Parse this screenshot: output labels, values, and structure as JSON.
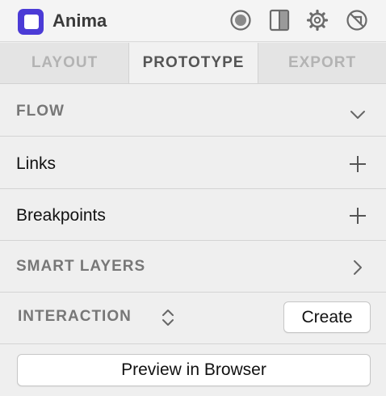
{
  "header": {
    "app_title": "Anima",
    "brand_color": "#4b3bd6",
    "icons": [
      "record-icon",
      "panel-toggle-icon",
      "gear-icon",
      "disable-icon"
    ]
  },
  "tabs": [
    {
      "label": "LAYOUT",
      "active": false
    },
    {
      "label": "PROTOTYPE",
      "active": true
    },
    {
      "label": "EXPORT",
      "active": false
    }
  ],
  "sections": {
    "flow": {
      "label": "FLOW",
      "icon": "chevron-down-icon"
    },
    "links": {
      "label": "Links",
      "icon": "plus-icon"
    },
    "breakpoints": {
      "label": "Breakpoints",
      "icon": "plus-icon"
    },
    "smart_layers": {
      "label": "SMART LAYERS",
      "icon": "chevron-right-icon"
    },
    "interaction": {
      "label": "INTERACTION",
      "icon": "up-down-chevron-icon",
      "create_label": "Create"
    }
  },
  "preview_label": "Preview in Browser"
}
